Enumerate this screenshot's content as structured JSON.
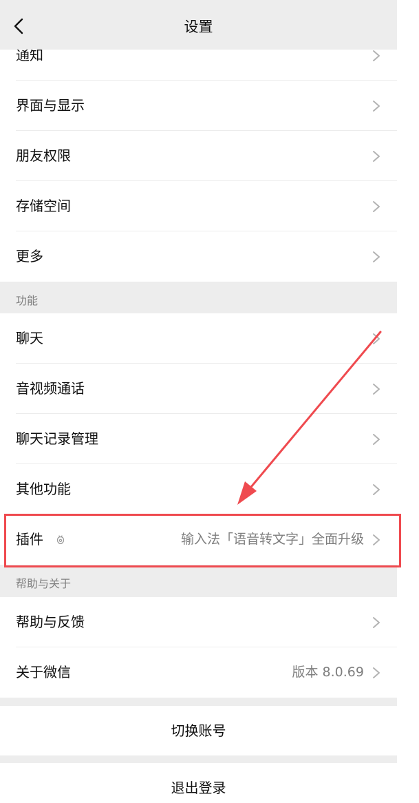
{
  "header": {
    "title": "设置"
  },
  "group1": {
    "items": [
      {
        "label": "通知"
      },
      {
        "label": "界面与显示"
      },
      {
        "label": "朋友权限"
      },
      {
        "label": "存储空间"
      },
      {
        "label": "更多"
      }
    ]
  },
  "section_features": {
    "title": "功能",
    "items": [
      {
        "label": "聊天"
      },
      {
        "label": "音视频通话"
      },
      {
        "label": "聊天记录管理"
      },
      {
        "label": "其他功能"
      }
    ]
  },
  "plugin": {
    "label": "插件",
    "icon": "plugin-icon",
    "value": "输入法「语音转文字」全面升级"
  },
  "section_help": {
    "title": "帮助与关于",
    "items": [
      {
        "label": "帮助与反馈",
        "value": ""
      },
      {
        "label": "关于微信",
        "value": "版本 8.0.69"
      }
    ]
  },
  "actions": {
    "switch_account": "切换账号",
    "logout": "退出登录"
  },
  "colors": {
    "background": "#ededed",
    "annotation": "#ef4a4f"
  }
}
